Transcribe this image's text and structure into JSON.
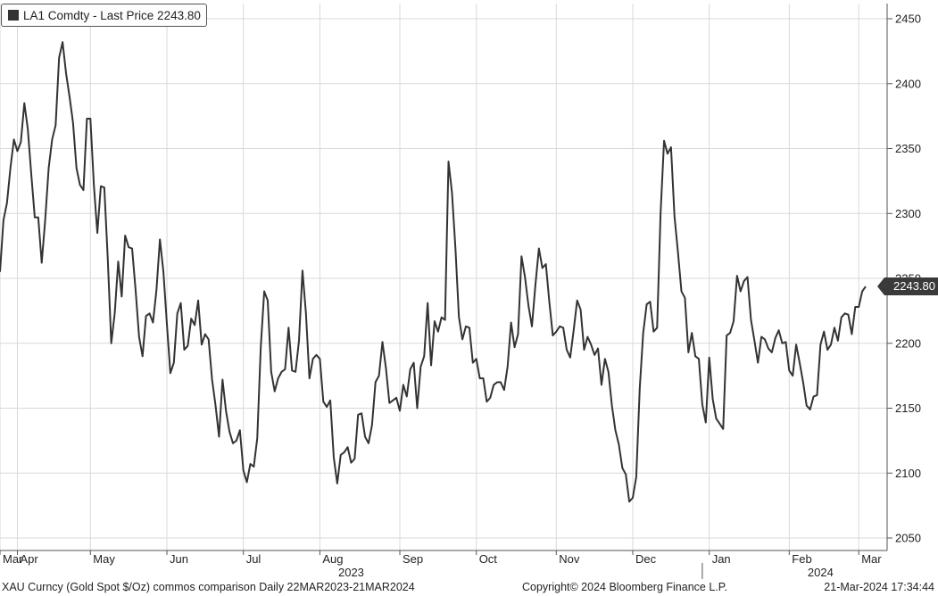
{
  "legend": {
    "text": "LA1 Comdty - Last Price 2243.80",
    "swatch_color": "#333333"
  },
  "last_price_tag": "2243.80",
  "footer": {
    "left": "XAU Curncy (Gold Spot  $/Oz) commos comparison  Daily 22MAR2023-21MAR2024",
    "center": "Copyright© 2024 Bloomberg Finance L.P.",
    "right": "21-Mar-2024 17:34:44"
  },
  "chart_data": {
    "type": "line",
    "title": "",
    "ylim": [
      2040,
      2460
    ],
    "yticks": [
      2050,
      2100,
      2150,
      2200,
      2250,
      2300,
      2350,
      2400,
      2450
    ],
    "ytick_labels": [
      "2050",
      "2100",
      "2150",
      "2200",
      "2250",
      "2300",
      "2350",
      "2400",
      "2450"
    ],
    "xticks": [
      {
        "label": "Mar",
        "i": 0
      },
      {
        "label": "Apr",
        "i": 5
      },
      {
        "label": "May",
        "i": 26
      },
      {
        "label": "Jun",
        "i": 48
      },
      {
        "label": "Jul",
        "i": 70
      },
      {
        "label": "Aug",
        "i": 92
      },
      {
        "label": "Sep",
        "i": 115
      },
      {
        "label": "Oct",
        "i": 137
      },
      {
        "label": "Nov",
        "i": 160
      },
      {
        "label": "Dec",
        "i": 182
      },
      {
        "label": "Jan",
        "i": 204
      },
      {
        "label": "Feb",
        "i": 227
      },
      {
        "label": "Mar",
        "i": 247
      }
    ],
    "year_labels": [
      {
        "label": "2023",
        "i": 101
      },
      {
        "label": "2024",
        "i": 236
      }
    ],
    "year_divider_i": 202,
    "grid": true,
    "line_color": "#333333",
    "series": [
      {
        "name": "LA1 Comdty",
        "values": [
          2255,
          2295,
          2308,
          2335,
          2357,
          2348,
          2355,
          2385,
          2365,
          2330,
          2297,
          2297,
          2262,
          2295,
          2335,
          2357,
          2368,
          2420,
          2432,
          2408,
          2390,
          2370,
          2335,
          2322,
          2318,
          2373,
          2373,
          2322,
          2285,
          2321,
          2320,
          2265,
          2200,
          2223,
          2263,
          2236,
          2283,
          2274,
          2273,
          2241,
          2205,
          2190,
          2221,
          2223,
          2216,
          2241,
          2280,
          2255,
          2215,
          2177,
          2185,
          2223,
          2231,
          2195,
          2198,
          2219,
          2214,
          2233,
          2199,
          2207,
          2203,
          2172,
          2152,
          2128,
          2172,
          2148,
          2132,
          2123,
          2125,
          2133,
          2102,
          2093,
          2107,
          2105,
          2127,
          2197,
          2240,
          2233,
          2178,
          2163,
          2173,
          2178,
          2180,
          2212,
          2179,
          2178,
          2202,
          2256,
          2223,
          2173,
          2188,
          2191,
          2188,
          2155,
          2151,
          2156,
          2112,
          2092,
          2114,
          2116,
          2120,
          2108,
          2111,
          2145,
          2146,
          2128,
          2123,
          2137,
          2170,
          2175,
          2201,
          2181,
          2154,
          2156,
          2158,
          2148,
          2168,
          2159,
          2180,
          2185,
          2150,
          2182,
          2190,
          2231,
          2183,
          2217,
          2209,
          2220,
          2218,
          2340,
          2316,
          2273,
          2220,
          2203,
          2213,
          2212,
          2185,
          2188,
          2173,
          2173,
          2155,
          2158,
          2168,
          2170,
          2170,
          2164,
          2182,
          2216,
          2197,
          2207,
          2267,
          2251,
          2229,
          2213,
          2245,
          2273,
          2258,
          2261,
          2232,
          2206,
          2209,
          2213,
          2212,
          2195,
          2189,
          2210,
          2233,
          2226,
          2195,
          2205,
          2199,
          2191,
          2196,
          2168,
          2188,
          2178,
          2152,
          2133,
          2122,
          2104,
          2099,
          2078,
          2081,
          2097,
          2165,
          2208,
          2230,
          2232,
          2209,
          2212,
          2300,
          2356,
          2346,
          2351,
          2298,
          2270,
          2240,
          2235,
          2193,
          2208,
          2190,
          2188,
          2153,
          2139,
          2189,
          2157,
          2142,
          2138,
          2134,
          2206,
          2208,
          2217,
          2252,
          2240,
          2248,
          2251,
          2218,
          2202,
          2185,
          2205,
          2203,
          2196,
          2193,
          2204,
          2210,
          2200,
          2201,
          2179,
          2175,
          2199,
          2185,
          2170,
          2152,
          2149,
          2159,
          2160,
          2199,
          2209,
          2195,
          2199,
          2212,
          2202,
          2220,
          2223,
          2222,
          2207,
          2228,
          2228,
          2240,
          2243.8
        ]
      }
    ]
  }
}
